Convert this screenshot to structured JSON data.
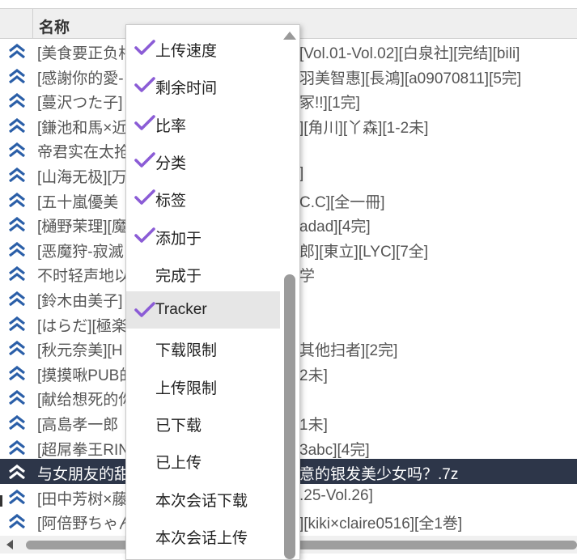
{
  "table": {
    "column_title": "名称",
    "rows": [
      {
        "left": "[美食要正负相",
        "right": "[Vol.01-Vol.02][白泉社][完结][bili]",
        "selected": false
      },
      {
        "left": "[感謝你的愛-",
        "right": "羽美智惠][長鴻][a09070811][5完]",
        "selected": false
      },
      {
        "left": "[蔓沢つた子]",
        "right": "冢!!][1完]",
        "selected": false
      },
      {
        "left": "[鎌池和馬×近",
        "right": "][角川][丫森][1-2未]",
        "selected": false
      },
      {
        "left": "帝君实在太抢",
        "right": "",
        "selected": false
      },
      {
        "left": "[山海无极][万",
        "right": "]",
        "selected": false
      },
      {
        "left": "[五十嵐優美",
        "right": "C.C][全一冊]",
        "selected": false
      },
      {
        "left": "[樋野茉理][魔",
        "right": "adad][4完]",
        "selected": false
      },
      {
        "left": "[恶魔狩-寂滅",
        "right": "郎][東立][LYC][7全]",
        "selected": false
      },
      {
        "left": "不时轻声地以",
        "right": "学",
        "selected": false
      },
      {
        "left": "[鈴木由美子]",
        "right": "",
        "selected": false
      },
      {
        "left": "[はらだ][極楽",
        "right": "",
        "selected": false
      },
      {
        "left": "[秋元奈美][H",
        "right": "其他扫者][2完]",
        "selected": false
      },
      {
        "left": "[摸摸啾PUB的",
        "right": "2未]",
        "selected": false
      },
      {
        "left": "[献给想死的你",
        "right": "",
        "selected": false
      },
      {
        "left": "[高島孝一郎",
        "right": "1未]",
        "selected": false
      },
      {
        "left": "[超屌拳王RIN",
        "right": "3abc][4完]",
        "selected": false
      },
      {
        "left": "与女朋友的甜",
        "right": "意的银发美少女吗？.7z",
        "selected": true
      },
      {
        "left": "[田中芳树×藤",
        "right": ".25-Vol.26]",
        "selected": false
      },
      {
        "left": "[阿倍野ちゃん",
        "right": "][kiki×claire0516][全1巻]",
        "selected": false
      }
    ]
  },
  "context_menu": {
    "items": [
      {
        "label": "上传速度",
        "checked": true,
        "hover": false
      },
      {
        "label": "剩余时间",
        "checked": true,
        "hover": false
      },
      {
        "label": "比率",
        "checked": true,
        "hover": false
      },
      {
        "label": "分类",
        "checked": true,
        "hover": false
      },
      {
        "label": "标签",
        "checked": true,
        "hover": false
      },
      {
        "label": "添加于",
        "checked": true,
        "hover": false
      },
      {
        "label": "完成于",
        "checked": false,
        "hover": false
      },
      {
        "label": "Tracker",
        "checked": true,
        "hover": true
      },
      {
        "label": "下载限制",
        "checked": false,
        "hover": false
      },
      {
        "label": "上传限制",
        "checked": false,
        "hover": false
      },
      {
        "label": "已下载",
        "checked": false,
        "hover": false
      },
      {
        "label": "已上传",
        "checked": false,
        "hover": false
      },
      {
        "label": "本次会话下载",
        "checked": false,
        "hover": false
      },
      {
        "label": "本次会话上传",
        "checked": false,
        "hover": false
      }
    ]
  },
  "icons": {
    "row_icon": "double-chevron-up-icon",
    "check_icon": "check-icon",
    "scroll_up_icon": "scroll-up-arrow-icon",
    "scroll_left_icon": "scroll-left-arrow-icon"
  },
  "colors": {
    "row_icon": "#2b5fa8",
    "check": "#8b5cd6",
    "selected_row": "#2d3649"
  }
}
